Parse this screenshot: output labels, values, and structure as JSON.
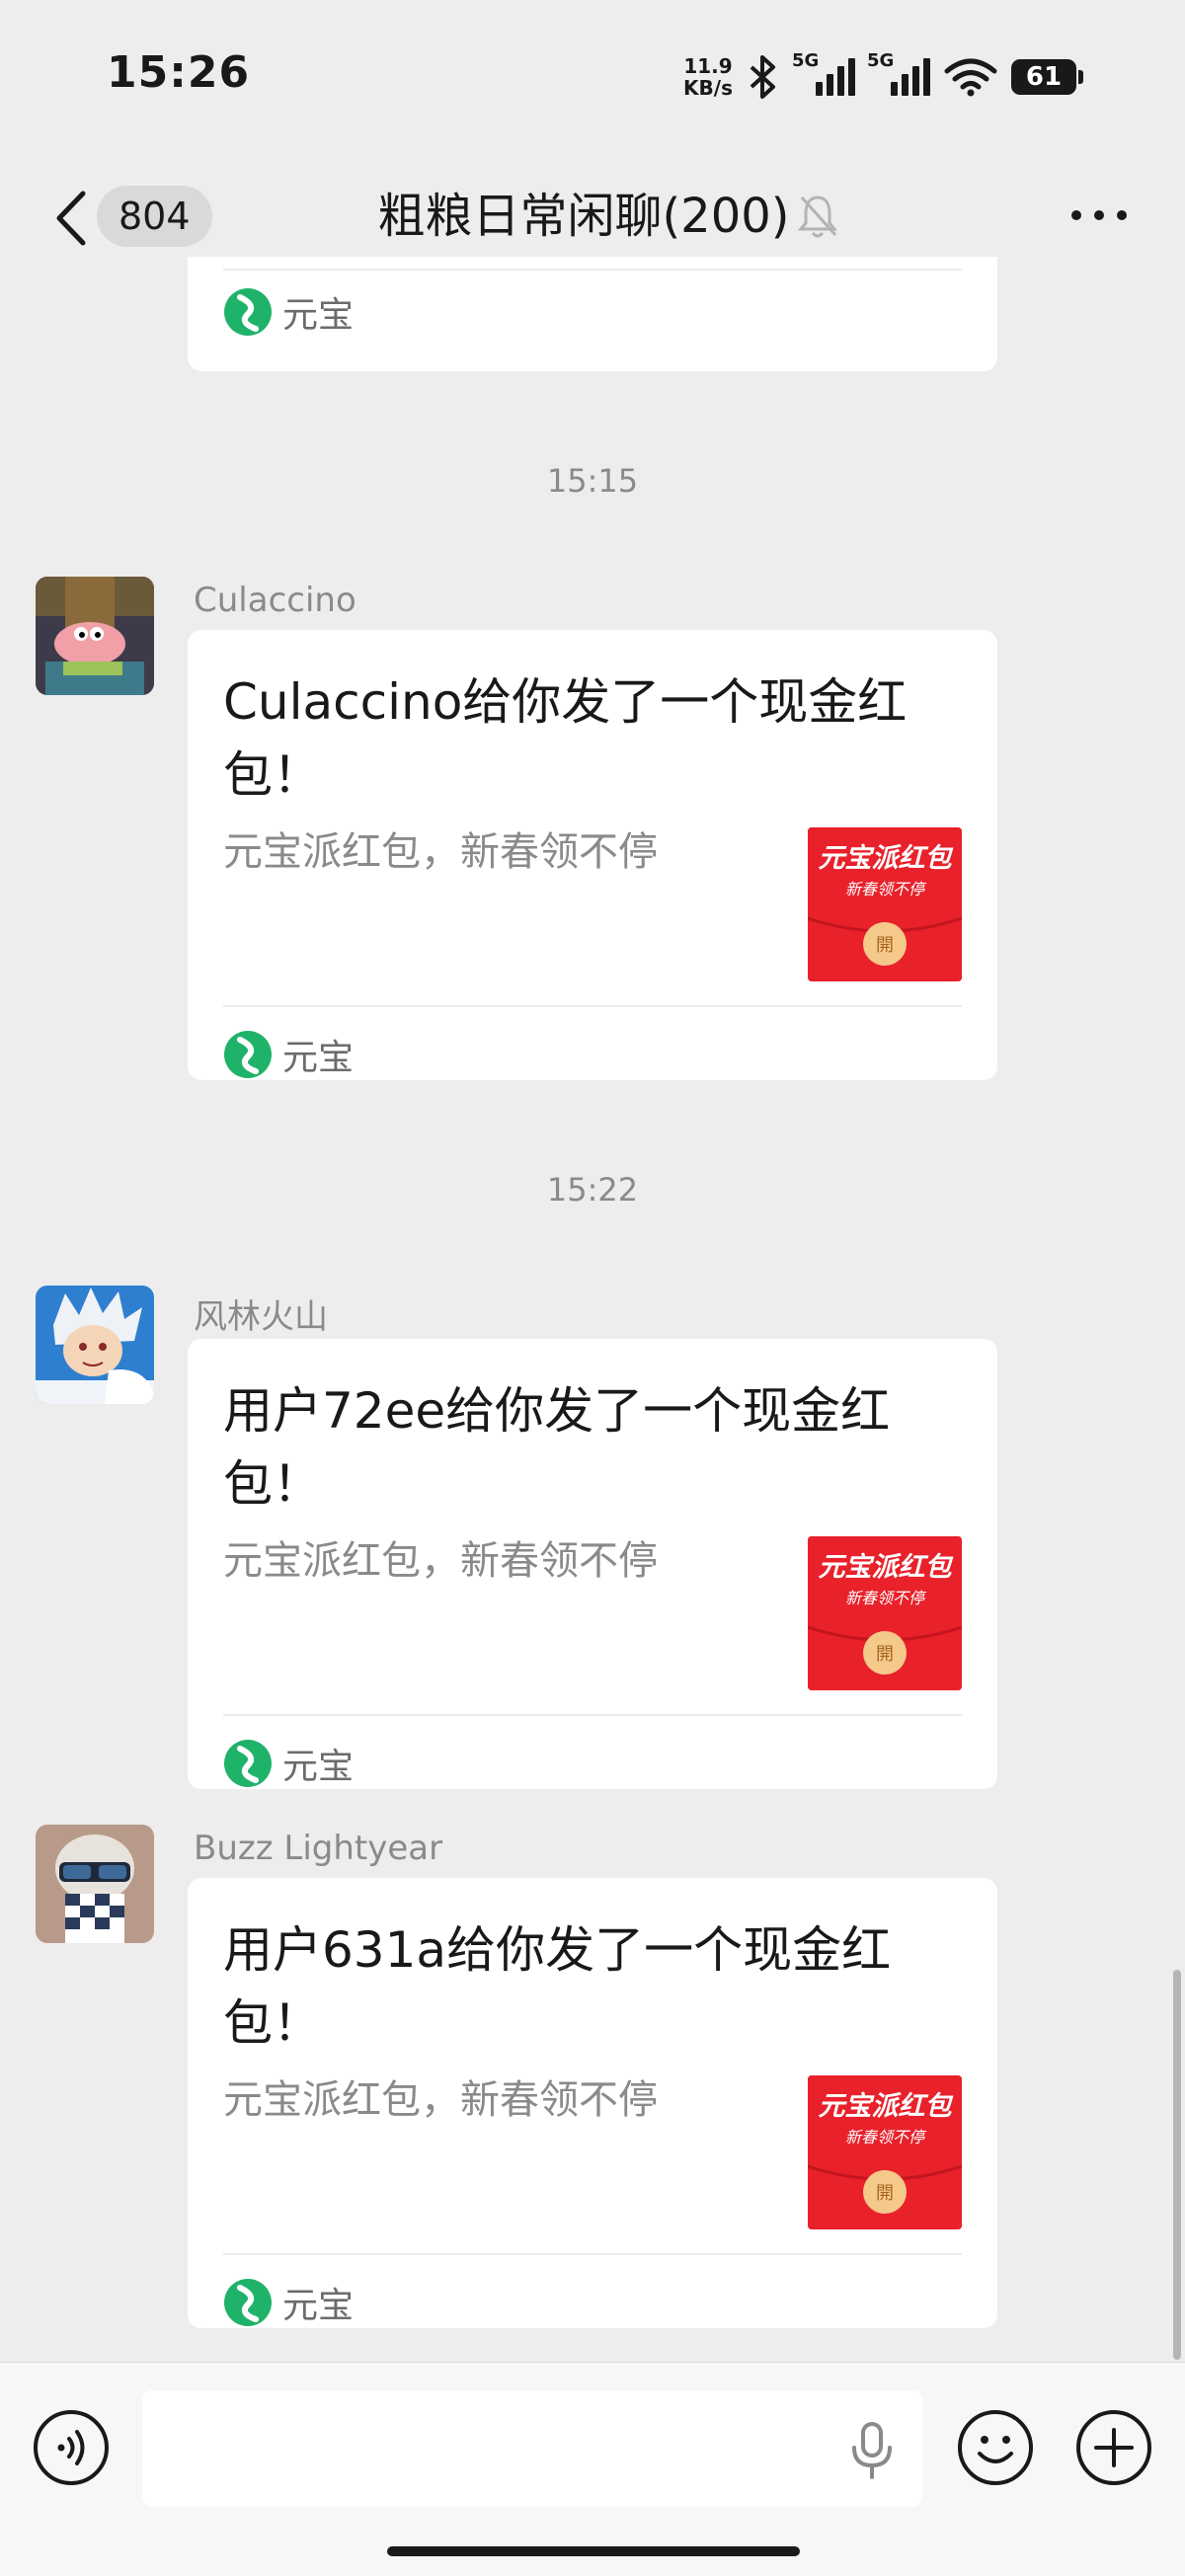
{
  "status_bar": {
    "time": "15:26",
    "net_speed_value": "11.9",
    "net_speed_unit": "KB/s",
    "signal1_label": "5G",
    "signal2_label": "5G",
    "battery": "61"
  },
  "header": {
    "back_count": "804",
    "title": "粗粮日常闲聊(200)"
  },
  "messages": [
    {
      "source_label": "元宝"
    },
    {
      "timestamp": "15:15",
      "sender": "Culaccino",
      "title": "Culaccino给你发了一个现金红包！",
      "desc": "元宝派红包，新春领不停",
      "thumb_title": "元宝派红包",
      "thumb_subtitle": "新春领不停",
      "thumb_open": "開",
      "source_label": "元宝"
    },
    {
      "timestamp": "15:22",
      "sender": "风林火山",
      "title": "用户72ee给你发了一个现金红包！",
      "desc": "元宝派红包，新春领不停",
      "thumb_title": "元宝派红包",
      "thumb_subtitle": "新春领不停",
      "thumb_open": "開",
      "source_label": "元宝"
    },
    {
      "sender": "Buzz Lightyear",
      "title": "用户631a给你发了一个现金红包！",
      "desc": "元宝派红包，新春领不停",
      "thumb_title": "元宝派红包",
      "thumb_subtitle": "新春领不停",
      "thumb_open": "開",
      "source_label": "元宝"
    }
  ],
  "input_bar": {
    "text_value": ""
  },
  "colors": {
    "background": "#ededed",
    "card": "#ffffff",
    "red_packet": "#e8212b",
    "yuanbao_green": "#1fb36a"
  },
  "icons": [
    "back-icon",
    "mute-bell-icon",
    "more-icon",
    "voice-icon",
    "mic-icon",
    "emoji-icon",
    "plus-icon",
    "yuanbao-logo-icon"
  ]
}
